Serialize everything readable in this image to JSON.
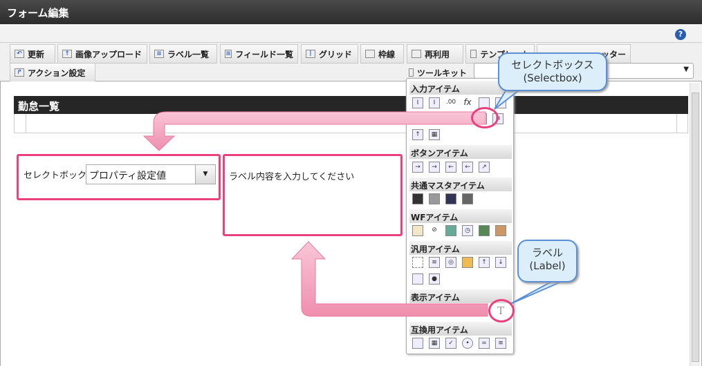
{
  "window": {
    "title": "フォーム編集"
  },
  "help_icon": "?",
  "tabs_row1": [
    {
      "label": "更新",
      "icon": "refresh-icon"
    },
    {
      "label": "画像アップロード",
      "icon": "image-upload-icon"
    },
    {
      "label": "ラベル一覧",
      "icon": "list-icon"
    },
    {
      "label": "フィールド一覧",
      "icon": "list-icon"
    },
    {
      "label": "グリッド",
      "icon": "grid-icon"
    },
    {
      "label": "枠線",
      "icon": "border-icon"
    },
    {
      "label": "再利用",
      "icon": "copy-icon"
    },
    {
      "label": "テンプレート",
      "icon": "template-icon"
    },
    {
      "label": "…ッター",
      "icon": "filter-icon"
    }
  ],
  "tabs_row2": [
    {
      "label": "アクション設定",
      "icon": "action-icon"
    },
    {
      "label": "ツールキット",
      "icon": "toolkit-icon"
    }
  ],
  "dropdown_arrow": "▼",
  "section": {
    "title": "勤怠一覧"
  },
  "form": {
    "select_label": "セレクトボックス",
    "select_value": "プロパティ設定値",
    "label_text": "ラベル内容を入力してください"
  },
  "palette": {
    "categories": [
      {
        "name": "入力アイテム",
        "items": [
          "textbox",
          "textarea",
          "number",
          "fx",
          "date",
          "datetime",
          "checkbox",
          "radio",
          "selectbox",
          "listbox",
          "upload",
          "table"
        ]
      },
      {
        "name": "ボタンアイテム",
        "items": [
          "btn-ok",
          "btn-next",
          "btn-back",
          "btn-prev",
          "btn-forward"
        ]
      },
      {
        "name": "共通マスタアイテム",
        "items": [
          "user",
          "organization",
          "user-org",
          "org-user"
        ]
      },
      {
        "name": "WFアイテム",
        "items": [
          "clipboard",
          "attachment",
          "image",
          "schedule",
          "user-search",
          "stamp"
        ]
      },
      {
        "name": "汎用アイテム",
        "items": [
          "dotted-box",
          "document",
          "camera",
          "key",
          "file-up",
          "file-down",
          "panel",
          "chart"
        ]
      },
      {
        "name": "表示アイテム",
        "items": [
          "label"
        ]
      },
      {
        "name": "互換用アイテム",
        "items": [
          "search",
          "table",
          "checkbox",
          "radio",
          "selectbox",
          "listbox"
        ]
      }
    ]
  },
  "callouts": {
    "selectbox": {
      "line1": "セレクトボックス",
      "line2": "(Selectbox)"
    },
    "label": {
      "line1": "ラベル",
      "line2": "(Label)"
    }
  },
  "colors": {
    "highlight": "#e8417e",
    "callout_bg": "#dbeef9",
    "callout_border": "#5b8fd6"
  }
}
